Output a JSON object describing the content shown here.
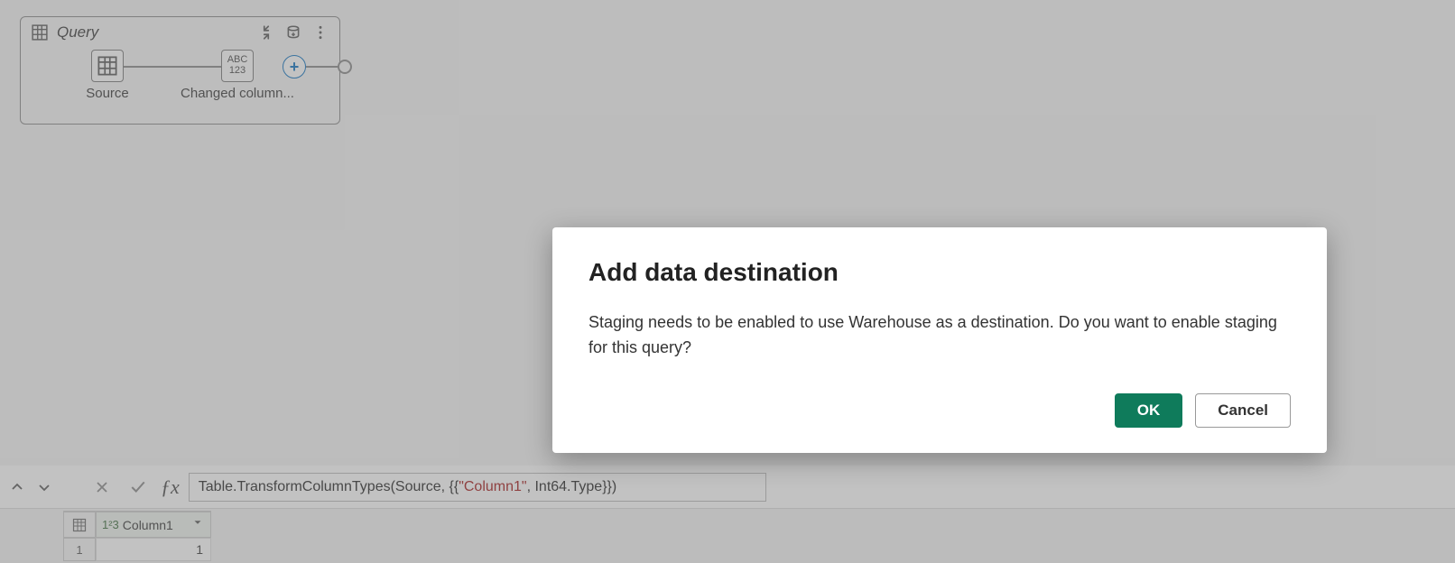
{
  "query_card": {
    "title": "Query",
    "steps": {
      "source": {
        "label": "Source"
      },
      "changed": {
        "label": "Changed column...",
        "box_top": "ABC",
        "box_bottom": "123"
      }
    }
  },
  "formula": {
    "prefix": "Table.TransformColumnTypes(Source, {{",
    "string_literal": "\"Column1\"",
    "suffix": ", Int64.Type}})"
  },
  "table": {
    "column_type_label": "1²3",
    "column_name": "Column1",
    "row1_index": "1",
    "row1_value": "1"
  },
  "dialog": {
    "title": "Add data destination",
    "body": "Staging needs to be enabled to use Warehouse as a destination. Do you want to enable staging for this query?",
    "ok_label": "OK",
    "cancel_label": "Cancel"
  }
}
